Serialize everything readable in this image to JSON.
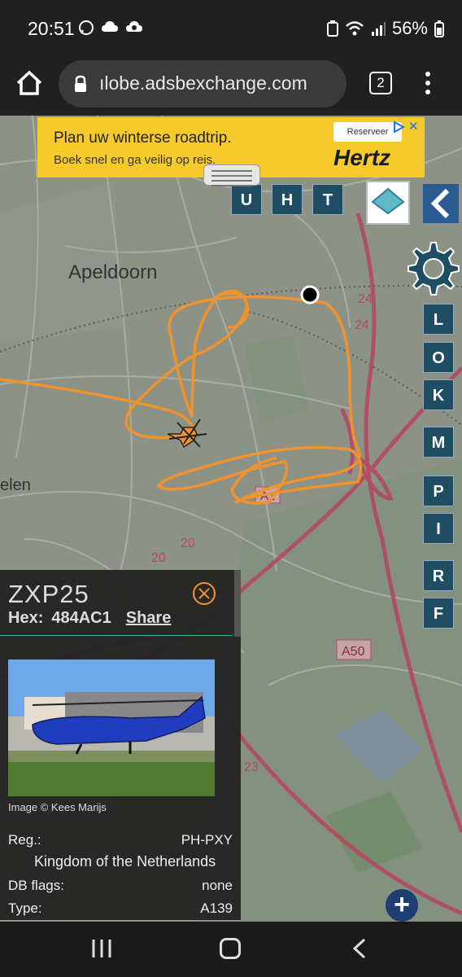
{
  "status_bar": {
    "time": "20:51",
    "battery": "56%",
    "icons": [
      "whatsapp-icon",
      "cloud-icon",
      "cloud-sync-icon",
      "battery-saver-icon",
      "wifi-icon",
      "signal-icon",
      "battery-icon"
    ]
  },
  "browser": {
    "url": "ılobe.adsbexchange.com",
    "tab_count": "2"
  },
  "ad": {
    "title": "Plan uw winterse roadtrip.",
    "subtitle": "Boek snel en ga veilig op reis.",
    "cta": "Reserveer",
    "brand": "Hertz"
  },
  "map": {
    "labels": {
      "city": "Apeldoorn",
      "city_partial": "elen",
      "road_a1": "A1",
      "road_a50": "A50",
      "road_24a": "24",
      "road_24b": "24",
      "road_20a": "20",
      "road_20b": "20",
      "road_23": "23"
    },
    "top_buttons": [
      "U",
      "H",
      "T"
    ],
    "side_buttons": [
      "L",
      "O",
      "K",
      "M",
      "P",
      "I",
      "R",
      "F"
    ],
    "colors": {
      "track": "#f0932c",
      "button": "#1e4d64",
      "highway": "#b24a63"
    }
  },
  "panel": {
    "callsign": "ZXP25",
    "hex_label": "Hex:",
    "hex": "484AC1",
    "share": "Share",
    "image_credit": "Image © Kees Marijs",
    "reg_label": "Reg.:",
    "reg": "PH-PXY",
    "country": "Kingdom of the Netherlands",
    "dbflags_label": "DB flags:",
    "dbflags": "none",
    "type_label": "Type:",
    "type": "A139"
  }
}
